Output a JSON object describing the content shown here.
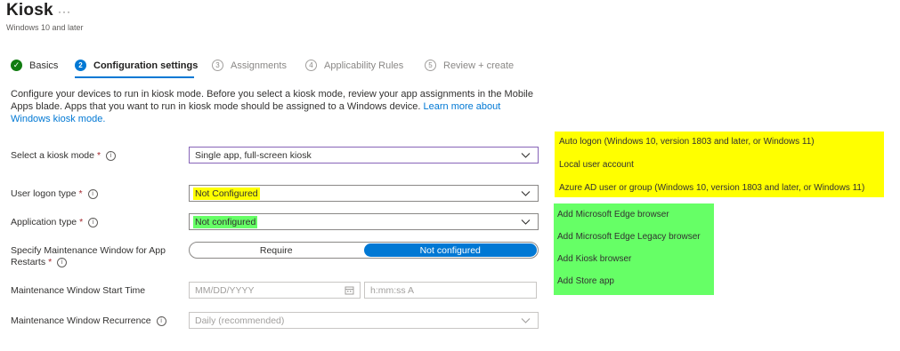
{
  "header": {
    "title": "Kiosk",
    "more": "···",
    "subtitle": "Windows 10 and later"
  },
  "steps": [
    {
      "number": "✓",
      "label": "Basics",
      "state": "done"
    },
    {
      "number": "2",
      "label": "Configuration settings",
      "state": "active"
    },
    {
      "number": "3",
      "label": "Assignments",
      "state": "todo"
    },
    {
      "number": "4",
      "label": "Applicability Rules",
      "state": "todo"
    },
    {
      "number": "5",
      "label": "Review + create",
      "state": "todo"
    }
  ],
  "description": {
    "text": "Configure your devices to run in kiosk mode. Before you select a kiosk mode, review your app assignments in the Mobile Apps blade. Apps that you want to run in kiosk mode should be assigned to a Windows device. ",
    "link": "Learn more about Windows kiosk mode."
  },
  "form": {
    "kiosk_mode": {
      "label": "Select a kiosk mode",
      "required": "*",
      "info": "i",
      "value": "Single app, full-screen kiosk"
    },
    "user_logon_type": {
      "label": "User logon type",
      "required": "*",
      "info": "i",
      "value": "Not Configured"
    },
    "application_type": {
      "label": "Application type",
      "required": "*",
      "info": "i",
      "value": "Not configured"
    },
    "maintenance_window": {
      "label": "Specify Maintenance Window for App Restarts",
      "required": "*",
      "info": "i",
      "options": [
        "Require",
        "Not configured"
      ],
      "selected": "Not configured"
    },
    "start_time": {
      "label": "Maintenance Window Start Time",
      "date_placeholder": "MM/DD/YYYY",
      "time_placeholder": "h:mm:ss A"
    },
    "recurrence": {
      "label": "Maintenance Window Recurrence",
      "info": "i",
      "value": "Daily (recommended)"
    }
  },
  "logon_options": [
    "Auto logon (Windows 10, version 1803 and later, or Windows 11)",
    "Local user account",
    "Azure AD user or group (Windows 10, version 1803 and later, or Windows 11)"
  ],
  "app_options": [
    "Add Microsoft Edge browser",
    "Add Microsoft Edge Legacy browser",
    "Add Kiosk browser",
    "Add Store app"
  ],
  "colors": {
    "accent": "#0078d4",
    "success": "#107c10",
    "highlight_yellow": "#ffff00",
    "highlight_green": "#66ff66"
  }
}
